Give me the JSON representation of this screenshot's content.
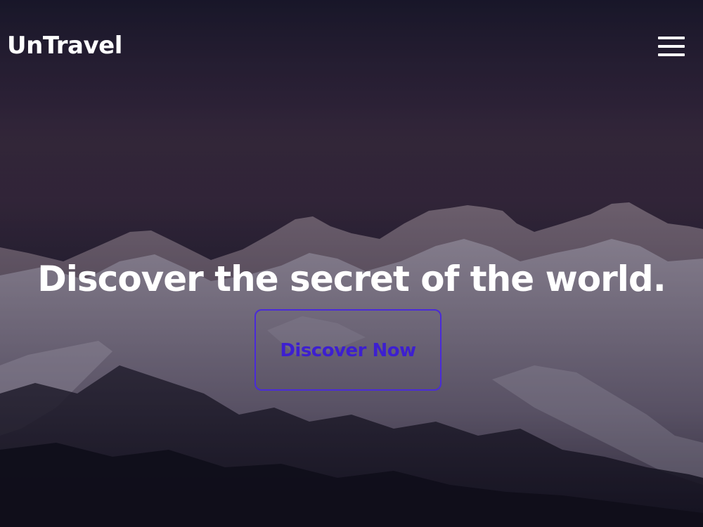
{
  "navbar": {
    "logo": "UnTravel",
    "menu_icon": "hamburger-menu-icon"
  },
  "hero": {
    "headline": "Discover the secret of the world.",
    "cta_label": "Discover Now",
    "background_image": "snowy-mountain-range-at-dusk",
    "colors": {
      "text": "#ffffff",
      "cta_accent": "#4a2bd8"
    }
  }
}
